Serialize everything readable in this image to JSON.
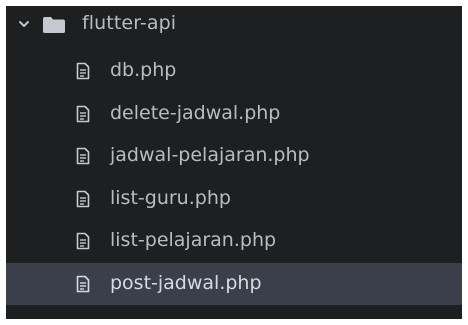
{
  "tree": {
    "folder": {
      "label": "flutter-api",
      "expanded": true,
      "icon": "folder-icon",
      "chevron_icon": "chevron-down-icon"
    },
    "files": [
      {
        "label": "db.php",
        "icon": "file-text-icon",
        "selected": false
      },
      {
        "label": "delete-jadwal.php",
        "icon": "file-text-icon",
        "selected": false
      },
      {
        "label": "jadwal-pelajaran.php",
        "icon": "file-text-icon",
        "selected": false
      },
      {
        "label": "list-guru.php",
        "icon": "file-text-icon",
        "selected": false
      },
      {
        "label": "list-pelajaran.php",
        "icon": "file-text-icon",
        "selected": false
      },
      {
        "label": "post-jadwal.php",
        "icon": "file-text-icon",
        "selected": true
      }
    ]
  },
  "colors": {
    "panel_bg": "#1d1f21",
    "selected_bg": "#3a3f4b",
    "text": "#b9bdc3",
    "icon": "#c6cad0"
  }
}
